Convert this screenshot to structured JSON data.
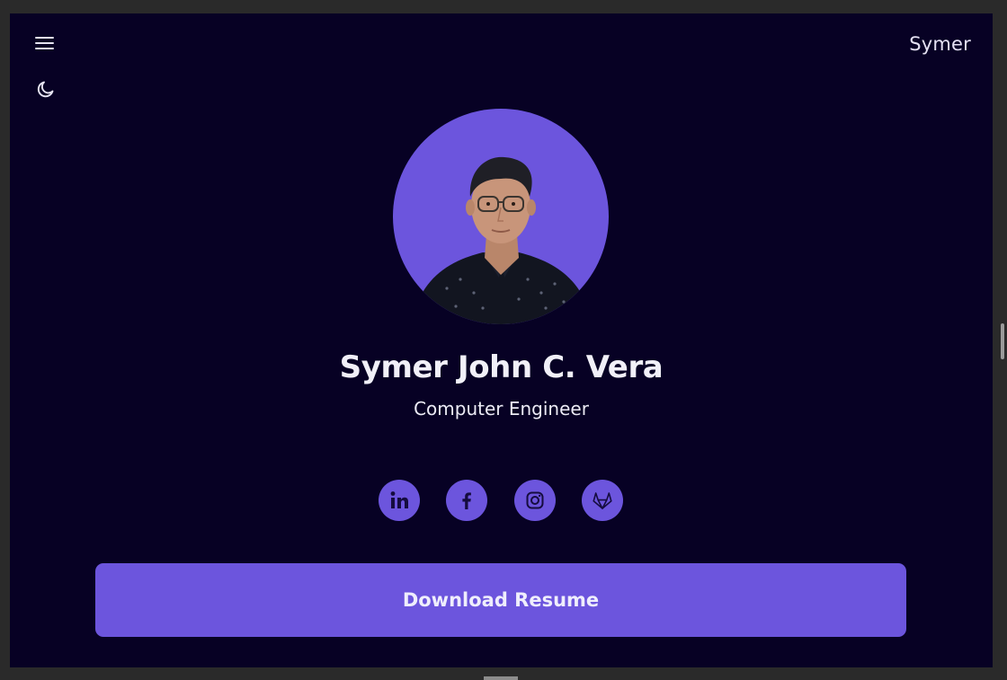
{
  "header": {
    "brand": "Symer",
    "menu_icon": "hamburger-menu-icon",
    "theme_icon": "moon-icon"
  },
  "profile": {
    "name": "Symer John C. Vera",
    "role": "Computer Engineer",
    "photo_icon": "profile-photo"
  },
  "social": [
    {
      "icon": "linkedin-icon",
      "label": "in"
    },
    {
      "icon": "facebook-icon",
      "label": "f"
    },
    {
      "icon": "instagram-icon"
    },
    {
      "icon": "gitlab-icon"
    }
  ],
  "actions": {
    "download_label": "Download Resume"
  },
  "colors": {
    "background": "#070124",
    "accent": "#6c55dd",
    "text": "#f1f0f8",
    "icon_dark": "#150c3f"
  }
}
